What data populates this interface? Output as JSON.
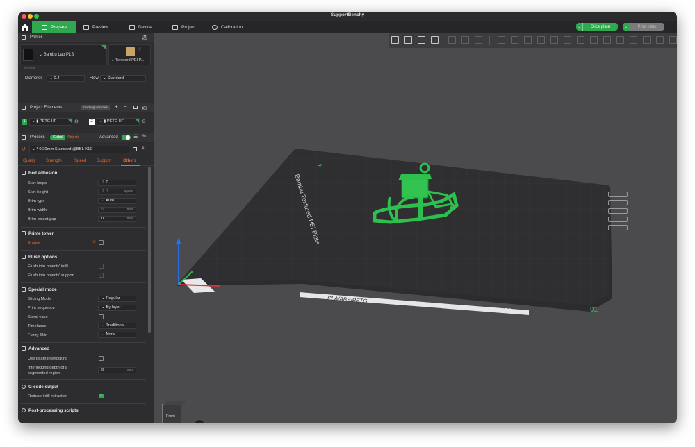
{
  "window": {
    "title": "SupportBenchy",
    "traffic_colors": [
      "#ff5f57",
      "#febc2e",
      "#28c840"
    ]
  },
  "tabs": [
    {
      "label": "Prepare",
      "icon": "cube-icon",
      "active": true
    },
    {
      "label": "Preview",
      "icon": "layers-icon",
      "active": false
    },
    {
      "label": "Device",
      "icon": "device-icon",
      "active": false
    },
    {
      "label": "Project",
      "icon": "project-icon",
      "active": false
    },
    {
      "label": "Calibration",
      "icon": "calibration-icon",
      "active": false
    }
  ],
  "actions": {
    "slice_label": "Slice plate",
    "print_label": "Print plate"
  },
  "printer": {
    "section_title": "Printer",
    "name": "Bambu Lab P1S",
    "plate": "Textured PEI P...",
    "nozzle_label": "Nozzle",
    "diameter_label": "Diameter",
    "diameter_value": "0.4",
    "flow_label": "Flow",
    "flow_value": "Standard"
  },
  "filaments": {
    "section_title": "Project Filaments",
    "flushing_label": "Flushing volumes",
    "items": [
      {
        "index": "1",
        "name": "PETG HF",
        "color": "#2fa84f"
      },
      {
        "index": "2",
        "name": "PETG HF",
        "color": "#ffffff"
      }
    ]
  },
  "process": {
    "section_title": "Process",
    "toggle_global": "Global",
    "toggle_objects": "Objects",
    "advanced_label": "Advanced",
    "advanced_on": true,
    "preset": "* 0.20mm Standard @BBL X1C",
    "subtabs": [
      "Quality",
      "Strength",
      "Speed",
      "Support",
      "Others"
    ],
    "active_subtab": "Others"
  },
  "settings": {
    "bed_adhesion": {
      "title": "Bed adhesion",
      "skirt_loops_label": "Skirt loops",
      "skirt_loops": "0",
      "skirt_height_label": "Skirt height",
      "skirt_height": "1",
      "skirt_height_unit": "layers",
      "brim_type_label": "Brim type",
      "brim_type": "Auto",
      "brim_width_label": "Brim width",
      "brim_width": "5",
      "brim_width_unit": "mm",
      "brim_gap_label": "Brim-object gap",
      "brim_gap": "0.1",
      "brim_gap_unit": "mm"
    },
    "prime_tower": {
      "title": "Prime tower",
      "enable_label": "Enable",
      "enable": false
    },
    "flush": {
      "title": "Flush options",
      "infill_label": "Flush into objects' infill",
      "support_label": "Flush into objects' support"
    },
    "special_mode": {
      "title": "Special mode",
      "slicing_mode_label": "Slicing Mode",
      "slicing_mode": "Regular",
      "print_sequence_label": "Print sequence",
      "print_sequence": "By layer",
      "spiral_vase_label": "Spiral vase",
      "timelapse_label": "Timelapse",
      "timelapse": "Traditional",
      "fuzzy_skin_label": "Fuzzy Skin",
      "fuzzy_skin": "None"
    },
    "advanced": {
      "title": "Advanced",
      "beam_label": "Use beam interlocking",
      "depth_label_1": "Interlocking depth of a",
      "depth_label_2": "segmented region",
      "depth": "0",
      "depth_unit": "mm"
    },
    "gcode": {
      "title": "G-code output",
      "retraction_label": "Reduce infill retraction",
      "retraction": true
    },
    "post": {
      "title": "Post-processing scripts"
    }
  },
  "viewport": {
    "plate_label": "Bambu Textured PEI Plate",
    "plate_strip": "PLA/ABS/PETG",
    "plate_number": "01",
    "view_cube_label": "Front",
    "accent": "#2fa84f",
    "axis_x_color": "#d9323a",
    "axis_y_color": "#36b44a",
    "axis_z_color": "#2b6ee6"
  }
}
